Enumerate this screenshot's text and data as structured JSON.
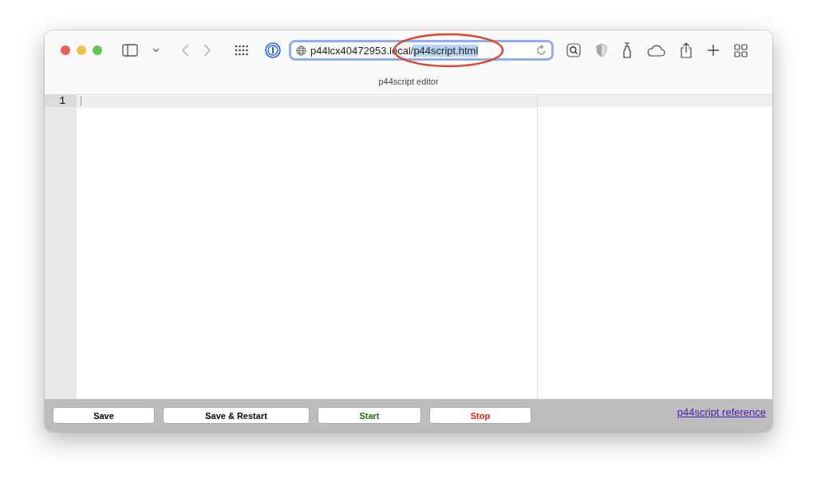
{
  "window": {
    "title": "p44script editor"
  },
  "address_bar": {
    "host": "p44lcx40472953.local/",
    "path": "p44script.html",
    "path_selected": true,
    "annotation_circled": true
  },
  "editor": {
    "line_numbers": [
      "1"
    ]
  },
  "buttons": [
    {
      "label": "Save",
      "color": "#000000"
    },
    {
      "label": "Save & Restart",
      "color": "#000000"
    },
    {
      "label": "Start",
      "color": "#2e6b14"
    },
    {
      "label": "Stop",
      "color": "#e8261c"
    }
  ],
  "reference_link": "p44script reference"
}
